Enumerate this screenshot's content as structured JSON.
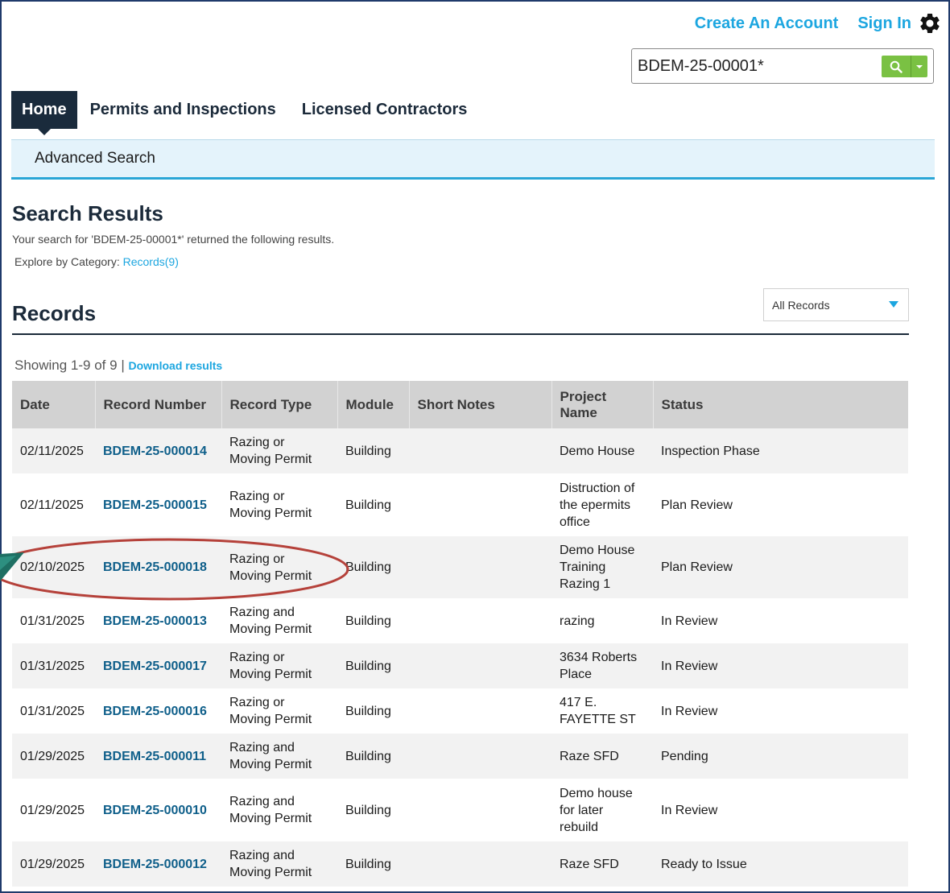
{
  "header": {
    "create_account": "Create An Account",
    "sign_in": "Sign In"
  },
  "search": {
    "value": "BDEM-25-00001*"
  },
  "nav": {
    "tabs": [
      "Home",
      "Permits and Inspections",
      "Licensed Contractors"
    ],
    "sub_items": [
      "Advanced Search"
    ]
  },
  "results": {
    "heading": "Search Results",
    "description": "Your search for 'BDEM-25-00001*' returned the following results.",
    "explore_label": "Explore by Category:",
    "explore_link": "Records(9)"
  },
  "records": {
    "heading": "Records",
    "filter_selected": "All Records",
    "showing": "Showing 1-9 of 9",
    "separator": "|",
    "download": "Download results",
    "columns": [
      "Date",
      "Record Number",
      "Record Type",
      "Module",
      "Short Notes",
      "Project Name",
      "Status"
    ],
    "rows": [
      {
        "date": "02/11/2025",
        "record_number": "BDEM-25-000014",
        "record_type": "Razing or Moving Permit",
        "module": "Building",
        "short_notes": "",
        "project_name": "Demo House",
        "status": "Inspection Phase"
      },
      {
        "date": "02/11/2025",
        "record_number": "BDEM-25-000015",
        "record_type": "Razing or Moving Permit",
        "module": "Building",
        "short_notes": "",
        "project_name": "Distruction of the epermits office",
        "status": "Plan Review"
      },
      {
        "date": "02/10/2025",
        "record_number": "BDEM-25-000018",
        "record_type": "Razing or Moving Permit",
        "module": "Building",
        "short_notes": "",
        "project_name": "Demo House Training Razing 1",
        "status": "Plan Review"
      },
      {
        "date": "01/31/2025",
        "record_number": "BDEM-25-000013",
        "record_type": "Razing and Moving Permit",
        "module": "Building",
        "short_notes": "",
        "project_name": "razing",
        "status": "In Review"
      },
      {
        "date": "01/31/2025",
        "record_number": "BDEM-25-000017",
        "record_type": "Razing or Moving Permit",
        "module": "Building",
        "short_notes": "",
        "project_name": "3634 Roberts Place",
        "status": "In Review"
      },
      {
        "date": "01/31/2025",
        "record_number": "BDEM-25-000016",
        "record_type": "Razing or Moving Permit",
        "module": "Building",
        "short_notes": "",
        "project_name": "417 E. FAYETTE ST",
        "status": "In Review"
      },
      {
        "date": "01/29/2025",
        "record_number": "BDEM-25-000011",
        "record_type": "Razing and Moving Permit",
        "module": "Building",
        "short_notes": "",
        "project_name": "Raze SFD",
        "status": "Pending"
      },
      {
        "date": "01/29/2025",
        "record_number": "BDEM-25-000010",
        "record_type": "Razing and Moving Permit",
        "module": "Building",
        "short_notes": "",
        "project_name": "Demo house for later rebuild",
        "status": "In Review"
      },
      {
        "date": "01/29/2025",
        "record_number": "BDEM-25-000012",
        "record_type": "Razing and Moving Permit",
        "module": "Building",
        "short_notes": "",
        "project_name": "Raze SFD",
        "status": "Ready to Issue"
      }
    ]
  },
  "colors": {
    "link": "#1ca6e0",
    "nav_dark": "#1a2b3c",
    "search_green": "#7ac143",
    "record_link": "#0f5f8a",
    "annotation_red": "#b5413a",
    "annotation_teal": "#1e6f63"
  },
  "icons": {
    "settings": "gear-icon",
    "search": "search-icon",
    "dropdown": "chevron-down-icon"
  }
}
